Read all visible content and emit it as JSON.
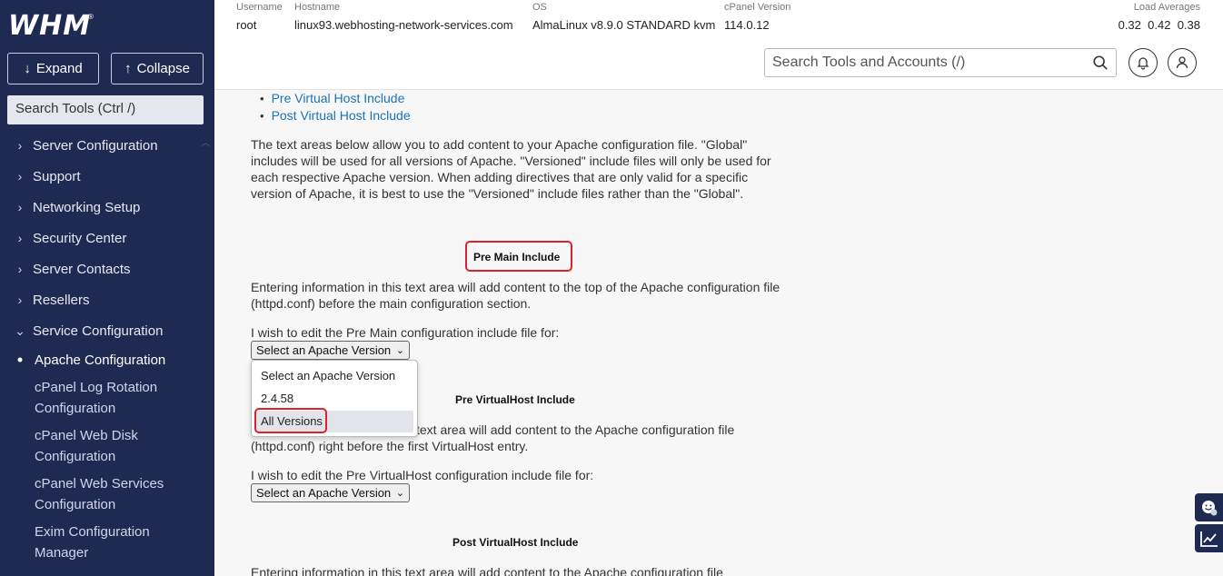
{
  "sidebar": {
    "logo": "WHM",
    "logo_reg": "®",
    "expand_label": "Expand",
    "collapse_label": "Collapse",
    "search_placeholder": "Search Tools (Ctrl /)",
    "items": [
      {
        "label": "Server Configuration"
      },
      {
        "label": "Support"
      },
      {
        "label": "Networking Setup"
      },
      {
        "label": "Security Center"
      },
      {
        "label": "Server Contacts"
      },
      {
        "label": "Resellers"
      },
      {
        "label": "Service Configuration"
      }
    ],
    "active_item": "Apache Configuration",
    "sub_items": [
      {
        "label": "cPanel Log Rotation Configuration"
      },
      {
        "label": "cPanel Web Disk Configuration"
      },
      {
        "label": "cPanel Web Services Configuration"
      },
      {
        "label": "Exim Configuration Manager"
      }
    ]
  },
  "header": {
    "username_label": "Username",
    "username": "root",
    "hostname_label": "Hostname",
    "hostname": "linux93.webhosting-network-services.com",
    "os_label": "OS",
    "os": "AlmaLinux v8.9.0 STANDARD kvm",
    "cpanel_label": "cPanel Version",
    "cpanel_version": "114.0.12",
    "load_label": "Load Averages",
    "load_1": "0.32",
    "load_2": "0.42",
    "load_3": "0.38",
    "search_placeholder": "Search Tools and Accounts (/)"
  },
  "content": {
    "links": [
      "Pre Virtual Host Include",
      "Post Virtual Host Include"
    ],
    "intro_text": "The text areas below allow you to add content to your Apache configuration file. \"Global\" includes will be used for all versions of Apache. \"Versioned\" include files will only be used for each respective Apache version. When adding directives that are only valid for a specific version of Apache, it is best to use the \"Versioned\" include files rather than the \"Global\".",
    "pre_main": {
      "title": "Pre Main Include",
      "desc": "Entering information in this text area will add content to the top of the Apache configuration file (httpd.conf) before the main configuration section.",
      "prompt": "I wish to edit the Pre Main configuration include file for:",
      "select_value": "Select an Apache Version"
    },
    "dropdown_options": [
      "Select an Apache Version",
      "2.4.58",
      "All Versions"
    ],
    "pre_vhost": {
      "title": "Pre VirtualHost Include",
      "desc_visible": "text area will add content to the Apache configuration file",
      "desc_line2": "(httpd.conf) right before the first VirtualHost entry.",
      "prompt": "I wish to edit the Pre VirtualHost configuration include file for:",
      "select_value": "Select an Apache Version"
    },
    "post_vhost": {
      "title": "Post VirtualHost Include",
      "desc": "Entering information in this text area will add content to the Apache configuration file"
    }
  },
  "colors": {
    "sidebar_bg": "#1f2a52",
    "link": "#1a73b8",
    "highlight": "#d9232f"
  }
}
